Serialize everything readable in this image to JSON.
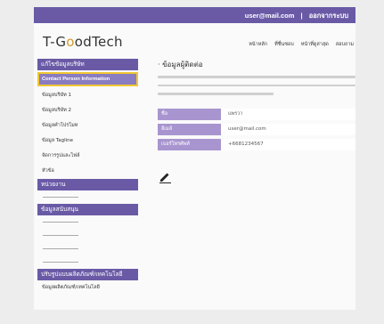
{
  "header": {
    "user_email": "user@mail.com",
    "separator": "|",
    "logout_label": "ออกจากระบบ"
  },
  "brand": {
    "logo_prefix": "T-G",
    "logo_o1": "o",
    "logo_o2": "o",
    "logo_suffix": "dTech"
  },
  "nav": {
    "items": [
      "หน้าหลัก",
      "ที่ชื่นชอบ",
      "หน้าที่ดูล่าสุด",
      "สอบถาม"
    ]
  },
  "sidebar": {
    "section1_title": "แก้ไขข้อมูลบริษัท",
    "active_item": "Contact Person Information",
    "items": [
      "ข้อมูลบริษัท 1",
      "ข้อมูลบริษัท 2",
      "ข้อมูลคำโปรโมท",
      "ข้อมูล Tagline",
      "จัดการรูปและไฟล์",
      "หัวข้อ"
    ],
    "section2_title": "หน่วยงาน",
    "section3_title": "ข้อมูลสนับสนุน",
    "section4_title": "ปรับรูปแบบผลิตภัณฑ์/เทคโนโลยี",
    "section4_items": [
      "ข้อมูลผลิตภัณฑ์/เทคโนโลยี"
    ]
  },
  "content": {
    "title": "· ข้อมูลผู้ติดต่อ",
    "fields": [
      {
        "label": "ชื่อ",
        "value": "แพรวา"
      },
      {
        "label": "อีเมล์",
        "value": "user@mail.com"
      },
      {
        "label": "เบอร์โทรศัพท์",
        "value": "+6681234567"
      }
    ]
  },
  "colors": {
    "accent": "#6a5aa6",
    "active_item_bg": "#8a7cc0",
    "active_item_border": "#f0c733",
    "field_label_bg": "#a895cf",
    "logo_highlight": "#d59a2a"
  },
  "icons": {
    "edit": "pencil-icon"
  }
}
